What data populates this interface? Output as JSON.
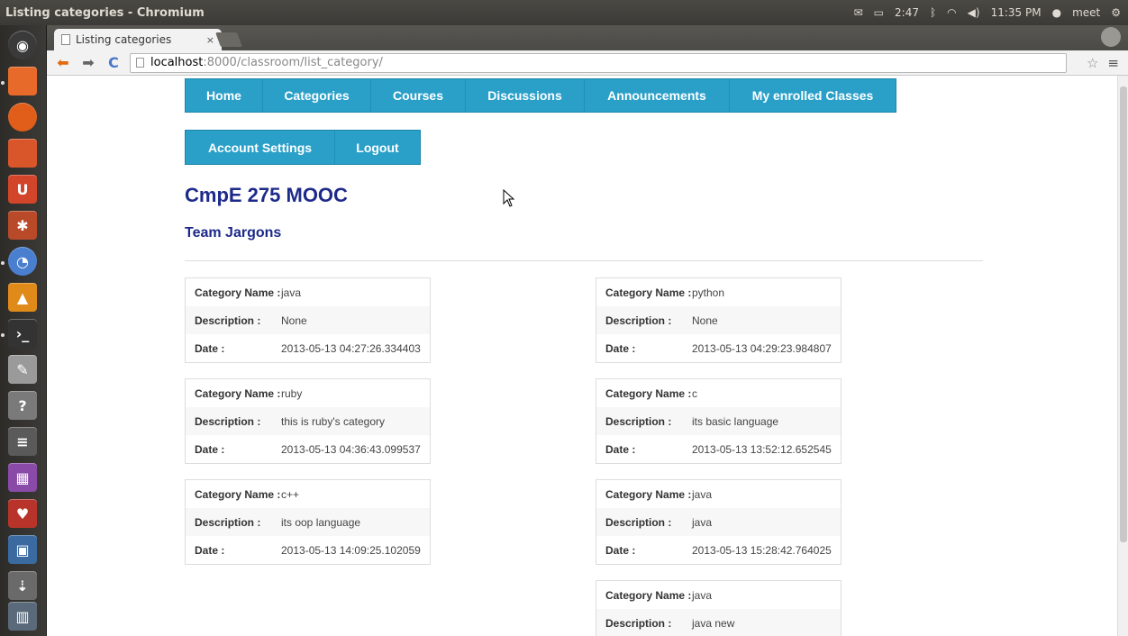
{
  "os_panel": {
    "window_title": "Listing categories - Chromium",
    "battery": "2:47",
    "clock": "11:35 PM",
    "user": "meet"
  },
  "browser": {
    "tab_title": "Listing categories",
    "tab_close": "×",
    "url_host": "localhost",
    "url_path": ":8000/classroom/list_category/"
  },
  "nav": {
    "primary": [
      "Home",
      "Categories",
      "Courses",
      "Discussions",
      "Announcements",
      "My enrolled Classes"
    ],
    "secondary": [
      "Account Settings",
      "Logout"
    ]
  },
  "page": {
    "title": "CmpE 275 MOOC",
    "subtitle": "Team Jargons"
  },
  "labels": {
    "name": "Category Name :",
    "description": "Description :",
    "date": "Date :"
  },
  "categories": [
    {
      "name": "java",
      "description": "None",
      "date": "2013-05-13 04:27:26.334403"
    },
    {
      "name": "python",
      "description": "None",
      "date": "2013-05-13 04:29:23.984807"
    },
    {
      "name": "ruby",
      "description": "this is ruby's category",
      "date": "2013-05-13 04:36:43.099537"
    },
    {
      "name": "c",
      "description": "its basic language",
      "date": "2013-05-13 13:52:12.652545"
    },
    {
      "name": "c++",
      "description": "its oop language",
      "date": "2013-05-13 14:09:25.102059"
    },
    {
      "name": "java",
      "description": "java",
      "date": "2013-05-13 15:28:42.764025"
    },
    {
      "name": "java",
      "description": "java new",
      "date": ""
    }
  ]
}
